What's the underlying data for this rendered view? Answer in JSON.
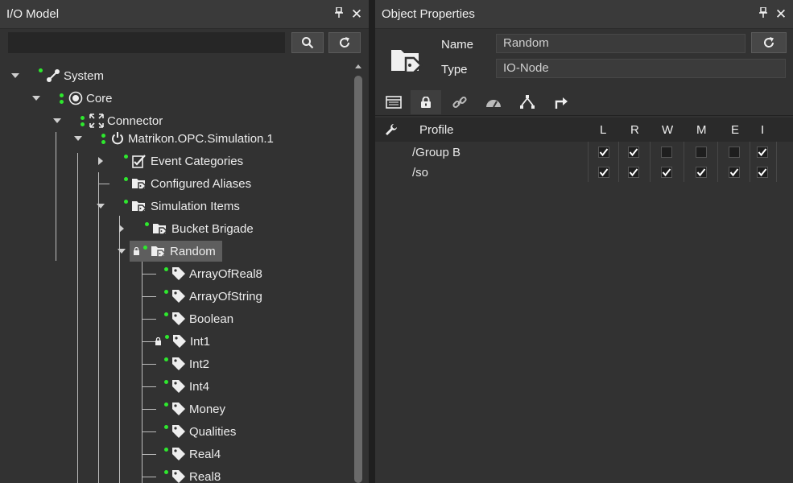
{
  "left_panel": {
    "title": "I/O Model",
    "search": {
      "value": "",
      "placeholder": ""
    },
    "tree": [
      {
        "label": "System",
        "icon": "link-icon",
        "expanded": true
      },
      {
        "label": "Core",
        "icon": "target-icon",
        "expanded": true
      },
      {
        "label": "Connector",
        "icon": "expand-arrows-icon",
        "expanded": true
      },
      {
        "label": "Matrikon.OPC.Simulation.1",
        "icon": "power-icon",
        "expanded": true
      },
      {
        "label": "Event Categories",
        "icon": "checklist-icon",
        "expanded": false
      },
      {
        "label": "Configured Aliases",
        "icon": "folder-tag-icon"
      },
      {
        "label": "Simulation Items",
        "icon": "folder-tag-icon",
        "expanded": true
      },
      {
        "label": "Bucket Brigade",
        "icon": "folder-tag-icon",
        "expanded": false
      },
      {
        "label": "Random",
        "icon": "folder-tag-icon",
        "expanded": true,
        "selected": true,
        "locked": true
      },
      {
        "label": "ArrayOfReal8",
        "icon": "tag-icon"
      },
      {
        "label": "ArrayOfString",
        "icon": "tag-icon"
      },
      {
        "label": "Boolean",
        "icon": "tag-icon"
      },
      {
        "label": "Int1",
        "icon": "tag-icon",
        "locked": true
      },
      {
        "label": "Int2",
        "icon": "tag-icon"
      },
      {
        "label": "Int4",
        "icon": "tag-icon"
      },
      {
        "label": "Money",
        "icon": "tag-icon"
      },
      {
        "label": "Qualities",
        "icon": "tag-icon"
      },
      {
        "label": "Real4",
        "icon": "tag-icon"
      },
      {
        "label": "Real8",
        "icon": "tag-icon"
      }
    ]
  },
  "right_panel": {
    "title": "Object Properties",
    "name_label": "Name",
    "name_value": "Random",
    "type_label": "Type",
    "type_value": "IO-Node",
    "tabs": [
      "general-tab-icon",
      "lock-tab-icon",
      "link-tab-icon",
      "gauge-tab-icon",
      "hierarchy-tab-icon",
      "route-tab-icon"
    ],
    "active_tab": 1,
    "grid": {
      "profile_header": "Profile",
      "columns": [
        "L",
        "R",
        "W",
        "M",
        "E",
        "I"
      ],
      "rows": [
        {
          "path": "/Group B",
          "checks": [
            true,
            true,
            false,
            false,
            false,
            true
          ]
        },
        {
          "path": "/so",
          "checks": [
            true,
            true,
            true,
            true,
            true,
            true
          ]
        }
      ]
    }
  },
  "colors": {
    "status_dot": "#2ee82e",
    "selected_bg": "#5e5e5e",
    "panel_bg": "#323232"
  }
}
